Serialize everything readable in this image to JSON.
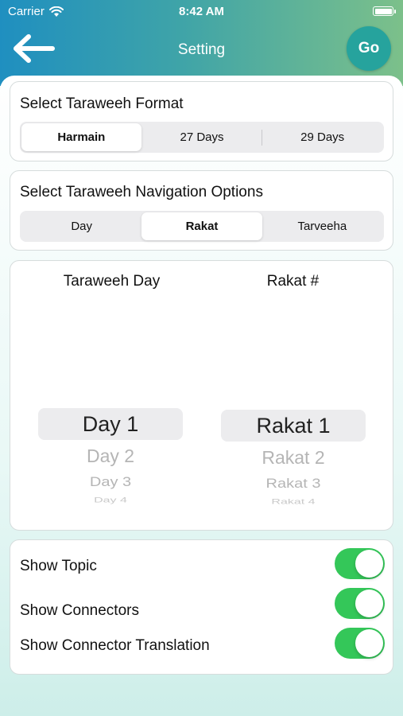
{
  "status_bar": {
    "carrier": "Carrier",
    "time": "8:42 AM"
  },
  "header": {
    "title": "Setting",
    "go_label": "Go"
  },
  "format_card": {
    "title": "Select Taraweeh Format",
    "options": [
      "Harmain",
      "27 Days",
      "29 Days"
    ],
    "selected": "Harmain"
  },
  "navigation_card": {
    "title": "Select Taraweeh Navigation Options",
    "options": [
      "Day",
      "Rakat",
      "Tarveeha"
    ],
    "selected": "Rakat"
  },
  "picker_card": {
    "day_title": "Taraweeh Day",
    "rakat_title": "Rakat #",
    "day_items": [
      "Day 1",
      "Day 2",
      "Day 3",
      "Day 4"
    ],
    "rakat_items": [
      "Rakat 1",
      "Rakat 2",
      "Rakat 3",
      "Rakat 4"
    ]
  },
  "toggles_card": {
    "items": [
      {
        "label": "Show Topic",
        "on": true
      },
      {
        "label": "Show Connectors",
        "on": true
      },
      {
        "label": "Show Connector Translation",
        "on": true
      }
    ]
  },
  "colors": {
    "accent_green": "#34c759",
    "go_button": "#26a39d"
  }
}
